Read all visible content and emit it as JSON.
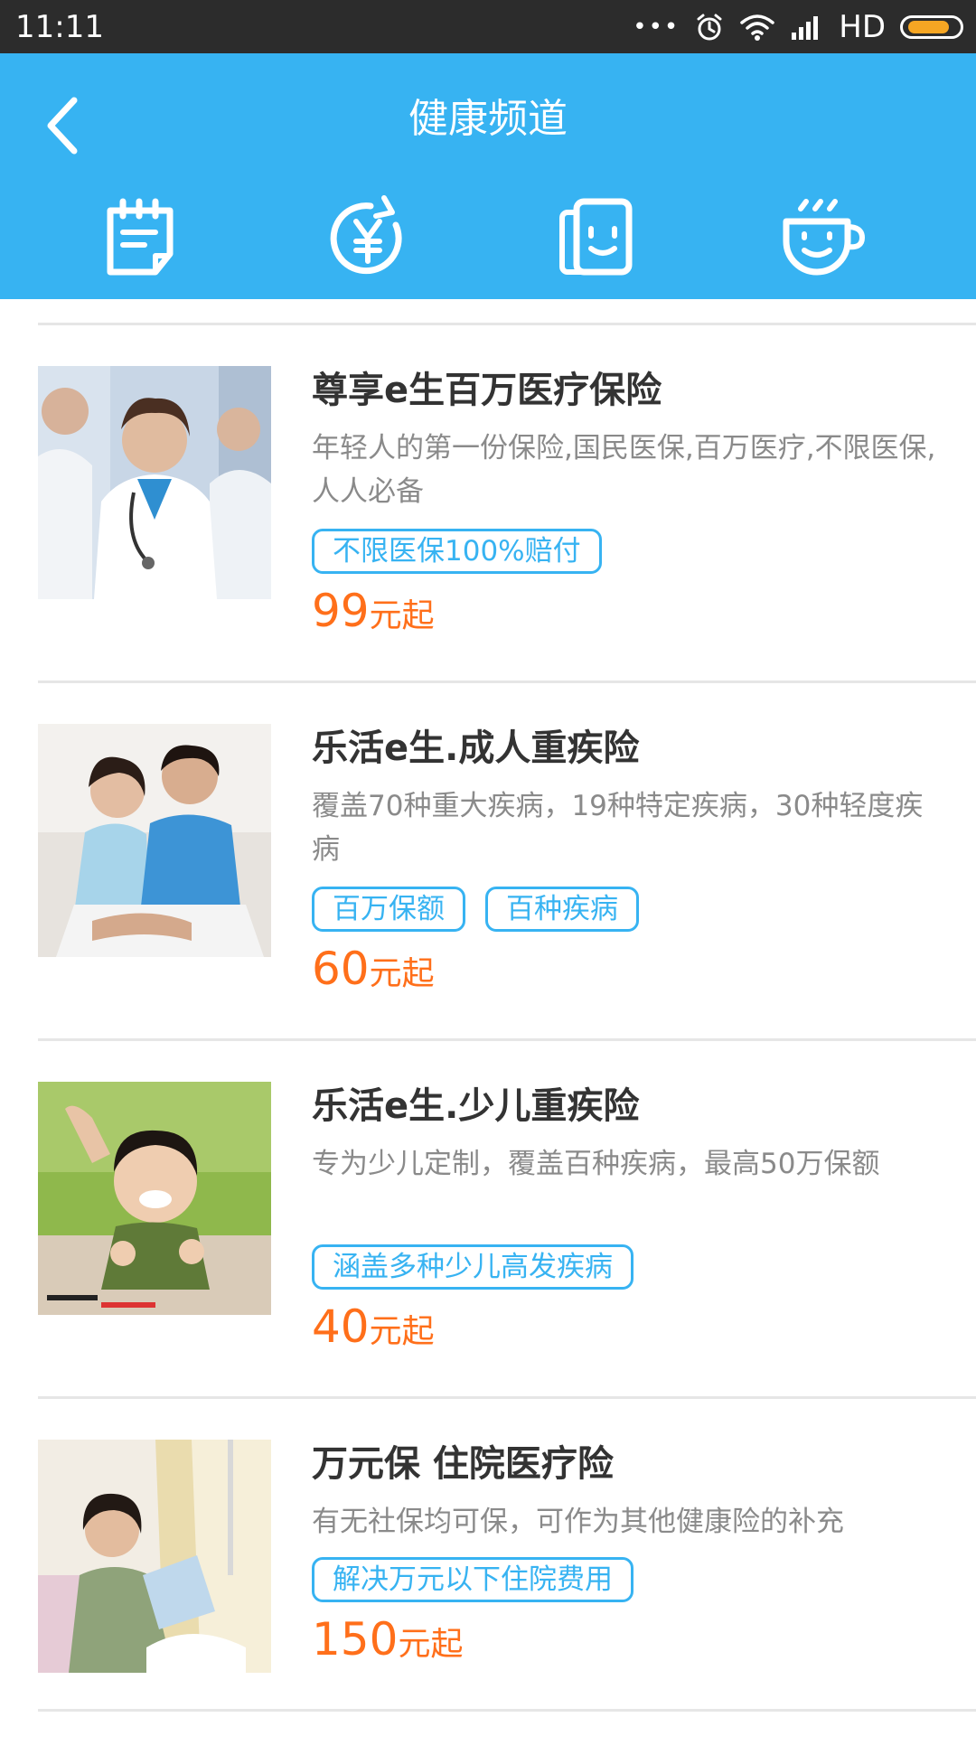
{
  "status_bar": {
    "time": "11:11",
    "dots": "•••",
    "network": "HD"
  },
  "header": {
    "title": "健康频道"
  },
  "nav_icons": [
    "notepad-icon",
    "yuan-refresh-icon",
    "documents-face-icon",
    "smiling-cup-icon"
  ],
  "colors": {
    "primary": "#37b3f2",
    "price": "#ff6f1a",
    "status_bar": "#2c2c2c",
    "battery": "#f6a623"
  },
  "products": [
    {
      "title": "尊享e生百万医疗保险",
      "desc": "年轻人的第一份保险,国民医保,百万医疗,不限医保,人人必备",
      "tags": [
        "不限医保100%赔付"
      ],
      "price": "99",
      "price_unit": "元起"
    },
    {
      "title": "乐活e生.成人重疾险",
      "desc": "覆盖70种重大疾病，19种特定疾病，30种轻度疾病",
      "tags": [
        "百万保额",
        "百种疾病"
      ],
      "price": "60",
      "price_unit": "元起"
    },
    {
      "title": "乐活e生.少儿重疾险",
      "desc": "专为少儿定制，覆盖百种疾病，最高50万保额",
      "tags": [
        "涵盖多种少儿高发疾病"
      ],
      "price": "40",
      "price_unit": "元起"
    },
    {
      "title": "万元保 住院医疗险",
      "desc": "有无社保均可保，可作为其他健康险的补充",
      "tags": [
        "解决万元以下住院费用"
      ],
      "price": "150",
      "price_unit": "元起"
    }
  ]
}
